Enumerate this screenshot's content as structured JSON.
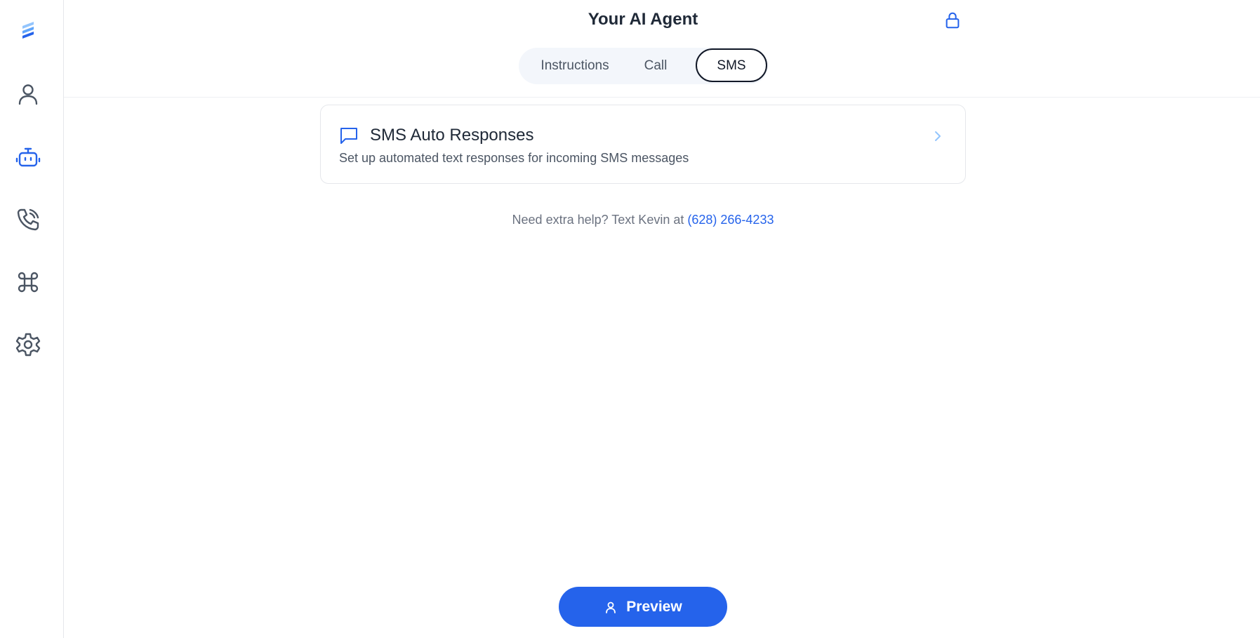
{
  "sidebar": {
    "items": [
      {
        "name": "logo-icon"
      },
      {
        "name": "user-icon"
      },
      {
        "name": "robot-icon",
        "active": true
      },
      {
        "name": "phone-icon"
      },
      {
        "name": "command-icon"
      },
      {
        "name": "gear-icon"
      }
    ]
  },
  "header": {
    "title": "Your AI Agent",
    "lock_icon": "lock-icon",
    "tabs": [
      {
        "label": "Instructions"
      },
      {
        "label": "Call"
      },
      {
        "label": "SMS",
        "selected": true
      }
    ]
  },
  "card": {
    "icon": "message-icon",
    "title": "SMS Auto Responses",
    "description": "Set up automated text responses for incoming SMS messages"
  },
  "help": {
    "text": "Need extra help? Text Kevin at",
    "phone": "(628) 266-4233"
  },
  "preview_button": {
    "label": "Preview"
  },
  "colors": {
    "accent": "#2563eb",
    "icon_gray": "#4b5563",
    "border": "#e5e7eb"
  }
}
